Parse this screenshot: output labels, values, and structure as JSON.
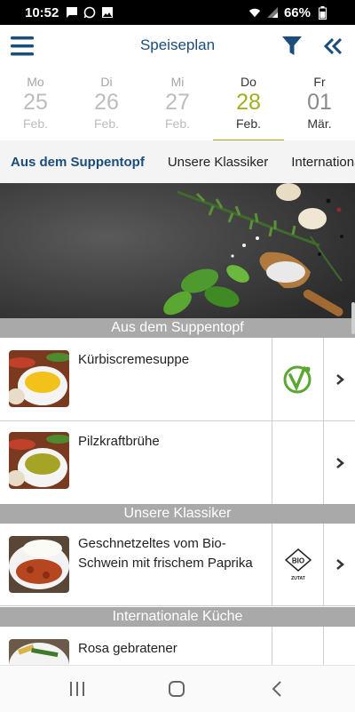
{
  "status_bar": {
    "time": "10:52",
    "battery": "66%"
  },
  "app_bar": {
    "title": "Speiseplan"
  },
  "dates": [
    {
      "weekday": "Mo",
      "day": "25",
      "month": "Feb."
    },
    {
      "weekday": "Di",
      "day": "26",
      "month": "Feb."
    },
    {
      "weekday": "Mi",
      "day": "27",
      "month": "Feb."
    },
    {
      "weekday": "Do",
      "day": "28",
      "month": "Feb."
    },
    {
      "weekday": "Fr",
      "day": "01",
      "month": "Mär."
    }
  ],
  "selected_date_index": 3,
  "tabs": [
    "Aus dem Suppentopf",
    "Unsere Klassiker",
    "Internationale Küche"
  ],
  "active_tab": 0,
  "sections": [
    {
      "title": "Aus dem Suppentopf",
      "items": [
        {
          "name": "Kürbiscremesuppe",
          "badge": "vegetarian-icon"
        },
        {
          "name": "Pilzkraftbrühe",
          "badge": ""
        }
      ]
    },
    {
      "title": "Unsere Klassiker",
      "items": [
        {
          "name": "Geschnetzeltes vom Bio-Schwein mit frischem Paprika",
          "badge": "bio-zutat-icon",
          "badge_text": "BIO",
          "badge_caption": "ZUTAT"
        }
      ]
    },
    {
      "title": "Internationale Küche",
      "items": [
        {
          "name": "Rosa gebratener",
          "badge": ""
        }
      ]
    }
  ],
  "colors": {
    "brand": "#1a4d7a",
    "accent": "#a3ad1f",
    "section": "#a9a9a9",
    "veg_green": "#5aa832"
  }
}
